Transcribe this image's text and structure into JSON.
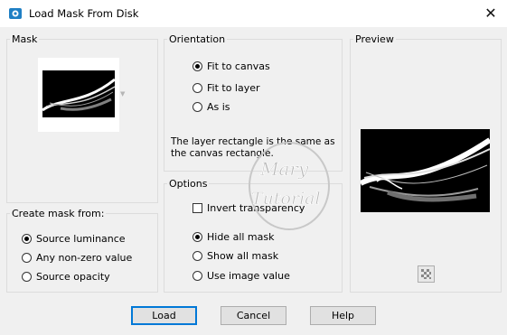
{
  "window": {
    "title": "Load Mask From Disk",
    "close_glyph": "✕",
    "app_icon": "app-icon"
  },
  "mask_group": {
    "legend": "Mask"
  },
  "create_group": {
    "legend": "Create mask from:",
    "options": [
      {
        "label": "Source luminance",
        "checked": true
      },
      {
        "label": "Any non-zero value",
        "checked": false
      },
      {
        "label": "Source opacity",
        "checked": false
      }
    ]
  },
  "orientation_group": {
    "legend": "Orientation",
    "options": [
      {
        "label": "Fit to canvas",
        "checked": true
      },
      {
        "label": "Fit to layer",
        "checked": false
      },
      {
        "label": "As is",
        "checked": false
      }
    ],
    "note": "The layer rectangle is the same as the canvas rectangle."
  },
  "options_group": {
    "legend": "Options",
    "invert_label": "Invert transparency",
    "invert_checked": false,
    "options": [
      {
        "label": "Hide all mask",
        "checked": true
      },
      {
        "label": "Show all mask",
        "checked": false
      },
      {
        "label": "Use image value",
        "checked": false
      }
    ]
  },
  "preview_group": {
    "legend": "Preview"
  },
  "watermark": {
    "line1": "Mary",
    "line2": "Tutorial"
  },
  "buttons": {
    "load": "Load",
    "cancel": "Cancel",
    "help": "Help"
  },
  "colors": {
    "accent": "#0078d7",
    "window_bg": "#f0f0f0",
    "title_bg": "#ffffff"
  }
}
